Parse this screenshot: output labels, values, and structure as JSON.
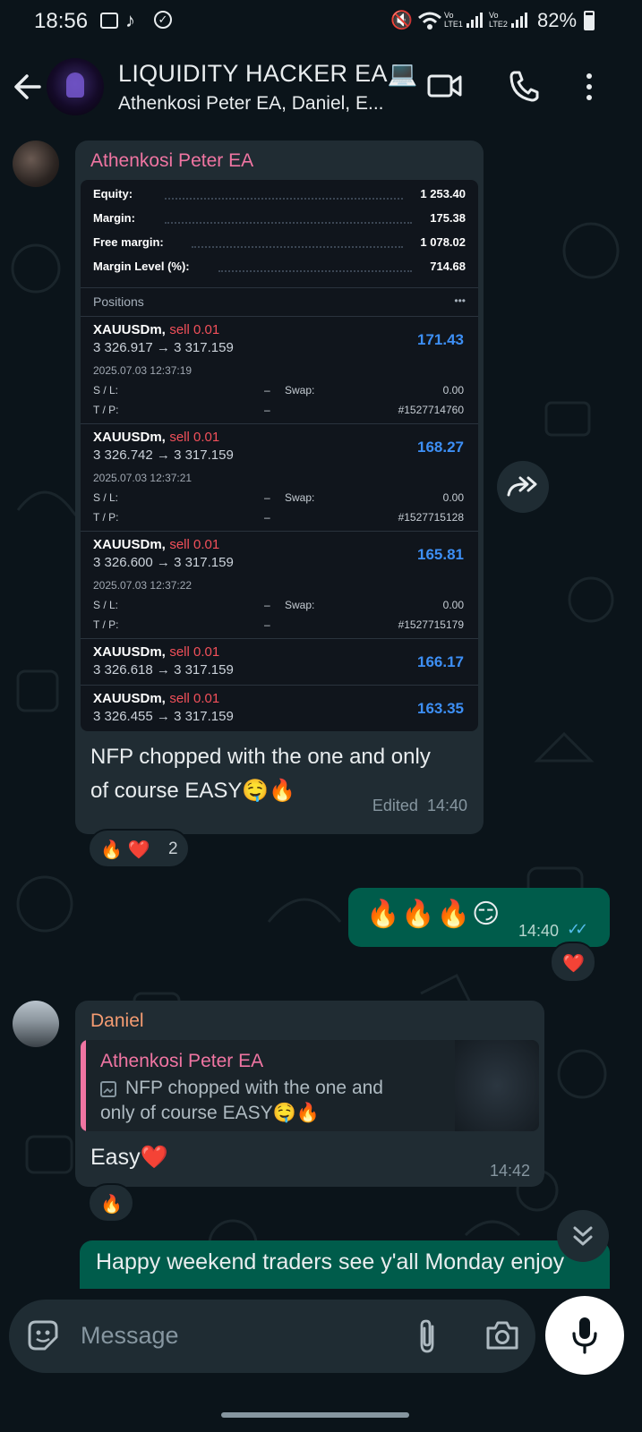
{
  "status_bar": {
    "time": "18:56",
    "network_1": "Vo LTE1",
    "network_2": "Vo LTE2",
    "battery": "82%"
  },
  "header": {
    "title": "LIQUIDITY HACKER EA💻",
    "subtitle": "Athenkosi Peter EA, Daniel, E..."
  },
  "messages": {
    "first": {
      "sender": "Athenkosi Peter EA",
      "sender_color": "#f075a2",
      "account": {
        "rows": [
          {
            "label": "Equity:",
            "value": "1 253.40"
          },
          {
            "label": "Margin:",
            "value": "175.38"
          },
          {
            "label": "Free margin:",
            "value": "1 078.02"
          },
          {
            "label": "Margin Level (%):",
            "value": "714.68"
          }
        ],
        "positions_label": "Positions",
        "more_label": "•••"
      },
      "positions": [
        {
          "symbol": "XAUUSDm,",
          "side": "sell 0.01",
          "prices": "3 326.917 → 3 317.159",
          "profit": "171.43",
          "date": "2025.07.03 12:37:19",
          "sl_label": "S / L:",
          "sl_value": "–",
          "tp_label": "T / P:",
          "tp_value": "–",
          "swap_label": "Swap:",
          "swap_value": "0.00",
          "ticket": "#1527714760"
        },
        {
          "symbol": "XAUUSDm,",
          "side": "sell 0.01",
          "prices": "3 326.742 → 3 317.159",
          "profit": "168.27",
          "date": "2025.07.03 12:37:21",
          "sl_label": "S / L:",
          "sl_value": "–",
          "tp_label": "T / P:",
          "tp_value": "–",
          "swap_label": "Swap:",
          "swap_value": "0.00",
          "ticket": "#1527715128"
        },
        {
          "symbol": "XAUUSDm,",
          "side": "sell 0.01",
          "prices": "3 326.600 → 3 317.159",
          "profit": "165.81",
          "date": "2025.07.03 12:37:22",
          "sl_label": "S / L:",
          "sl_value": "–",
          "tp_label": "T / P:",
          "tp_value": "–",
          "swap_label": "Swap:",
          "swap_value": "0.00",
          "ticket": "#1527715179"
        },
        {
          "symbol": "XAUUSDm,",
          "side": "sell 0.01",
          "prices": "3 326.618 → 3 317.159",
          "profit": "166.17"
        },
        {
          "symbol": "XAUUSDm,",
          "side": "sell 0.01",
          "prices": "3 326.455 → 3 317.159",
          "profit": "163.35"
        }
      ],
      "caption_line1": "NFP chopped with the one and only",
      "caption_line2": "of course EASY🤤🔥",
      "meta": "Edited  14:40",
      "reactions": "🔥 ❤️",
      "reaction_count": "2"
    },
    "second": {
      "text": "🔥🔥🔥😏",
      "time": "14:40",
      "ticks": "✓✓",
      "reaction": "❤️"
    },
    "third": {
      "sender": "Daniel",
      "sender_color": "#f59c72",
      "quote_sender": "Athenkosi Peter EA",
      "quote_line1": "NFP chopped with the one and",
      "quote_line2": "only of course EASY🤤🔥",
      "text": "Easy❤️",
      "time": "14:42",
      "reaction": "🔥"
    },
    "fourth": {
      "text": "Happy weekend traders see y'all Monday enjoy"
    }
  },
  "input": {
    "placeholder": "Message"
  },
  "colors": {
    "background": "#0b141a",
    "incoming_bubble": "#202c33",
    "outgoing_bubble": "#005c4b",
    "profit_blue": "#3d8ff5",
    "sell_red": "#f2505a"
  }
}
